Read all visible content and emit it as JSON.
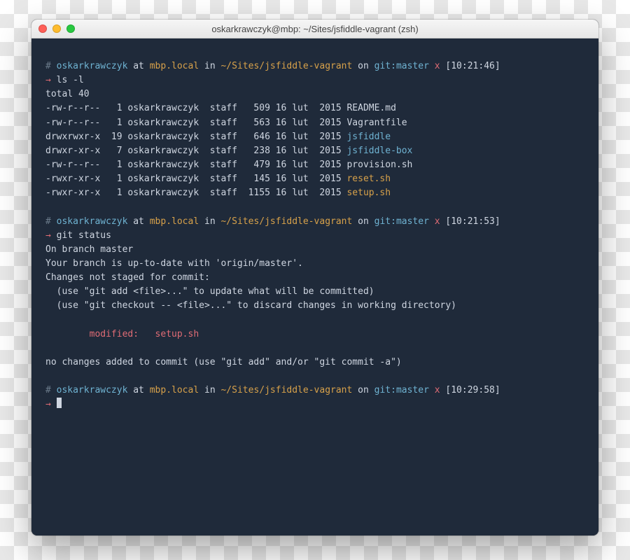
{
  "window": {
    "title": "oskarkrawczyk@mbp: ~/Sites/jsfiddle-vagrant (zsh)"
  },
  "prompt": {
    "hash": "#",
    "user": "oskarkrawczyk",
    "at": "at",
    "host": "mbp.local",
    "in": "in",
    "path": "~/Sites/jsfiddle-vagrant",
    "on": "on",
    "git_label": "git:",
    "branch": "master",
    "dirty": "x",
    "arrow": "→"
  },
  "blocks": [
    {
      "time": "[10:21:46]",
      "command": "ls -l",
      "total": "total 40",
      "listing": [
        {
          "perm": "-rw-r--r--",
          "links": "1",
          "owner": "oskarkrawczyk",
          "group": "staff",
          "size": "509",
          "date": "16 lut  2015",
          "name": "README.md",
          "kind": "file"
        },
        {
          "perm": "-rw-r--r--",
          "links": "1",
          "owner": "oskarkrawczyk",
          "group": "staff",
          "size": "563",
          "date": "16 lut  2015",
          "name": "Vagrantfile",
          "kind": "file"
        },
        {
          "perm": "drwxrwxr-x",
          "links": "19",
          "owner": "oskarkrawczyk",
          "group": "staff",
          "size": "646",
          "date": "16 lut  2015",
          "name": "jsfiddle",
          "kind": "dir"
        },
        {
          "perm": "drwxr-xr-x",
          "links": "7",
          "owner": "oskarkrawczyk",
          "group": "staff",
          "size": "238",
          "date": "16 lut  2015",
          "name": "jsfiddle-box",
          "kind": "dir"
        },
        {
          "perm": "-rw-r--r--",
          "links": "1",
          "owner": "oskarkrawczyk",
          "group": "staff",
          "size": "479",
          "date": "16 lut  2015",
          "name": "provision.sh",
          "kind": "file"
        },
        {
          "perm": "-rwxr-xr-x",
          "links": "1",
          "owner": "oskarkrawczyk",
          "group": "staff",
          "size": "145",
          "date": "16 lut  2015",
          "name": "reset.sh",
          "kind": "exec"
        },
        {
          "perm": "-rwxr-xr-x",
          "links": "1",
          "owner": "oskarkrawczyk",
          "group": "staff",
          "size": "1155",
          "date": "16 lut  2015",
          "name": "setup.sh",
          "kind": "exec"
        }
      ]
    },
    {
      "time": "[10:21:53]",
      "command": "git status",
      "status_lines": [
        "On branch master",
        "Your branch is up-to-date with 'origin/master'.",
        "Changes not staged for commit:",
        "  (use \"git add <file>...\" to update what will be committed)",
        "  (use \"git checkout -- <file>...\" to discard changes in working directory)"
      ],
      "modified_label": "modified:",
      "modified_file": "setup.sh",
      "footer": "no changes added to commit (use \"git add\" and/or \"git commit -a\")"
    },
    {
      "time": "[10:29:58]",
      "command": ""
    }
  ]
}
